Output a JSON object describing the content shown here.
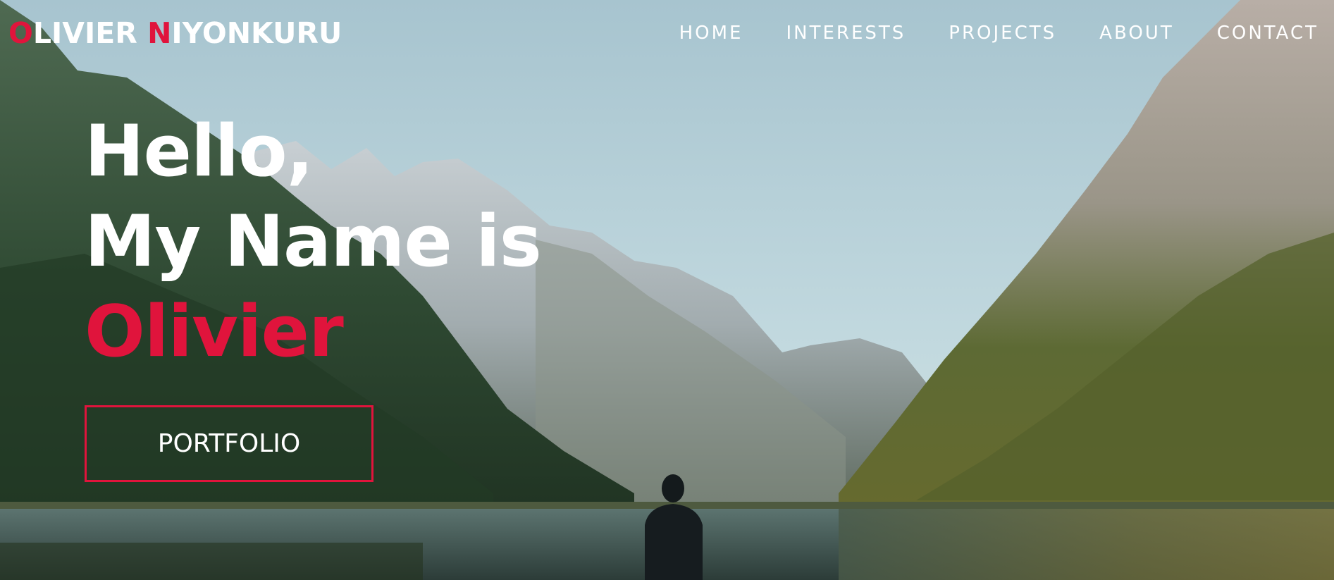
{
  "brand": {
    "first_initial": "O",
    "first_rest": "LIVIER ",
    "last_initial": "N",
    "last_rest": "IYONKURU"
  },
  "nav": {
    "items": [
      {
        "label": "HOME"
      },
      {
        "label": "INTERESTS"
      },
      {
        "label": "PROJECTS"
      },
      {
        "label": "ABOUT"
      },
      {
        "label": "CONTACT"
      }
    ]
  },
  "hero": {
    "line1": "Hello,",
    "line2": "My Name is",
    "name": "Olivier",
    "cta_label": "PORTFOLIO"
  },
  "colors": {
    "accent": "#e0143c",
    "text": "#ffffff",
    "sky": "#a9c8d4"
  },
  "background_image": "mountain-lake-landscape"
}
